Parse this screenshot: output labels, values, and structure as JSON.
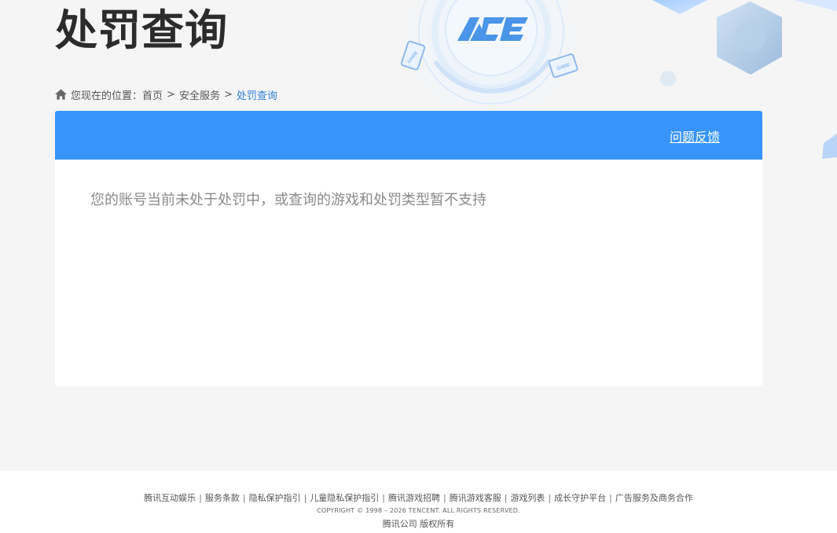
{
  "page": {
    "title": "处罚查询"
  },
  "banner": {
    "logo_text": "ACE",
    "badge_text_1": "GAME",
    "badge_text_2": "GAME"
  },
  "breadcrumb": {
    "prefix": "您现在的位置：",
    "items": [
      "首页",
      "安全服务",
      "处罚查询"
    ],
    "separator": ">"
  },
  "panel": {
    "feedback_label": "问题反馈",
    "message": "您的账号当前未处于处罚中，或查询的游戏和处罚类型暂不支持"
  },
  "footer": {
    "links": [
      "腾讯互动娱乐",
      "服务条款",
      "隐私保护指引",
      "儿童隐私保护指引",
      "腾讯游戏招聘",
      "腾讯游戏客服",
      "游戏列表",
      "成长守护平台",
      "广告服务及商务合作"
    ],
    "copyright": "COPYRIGHT © 1998 – 2026 TENCENT. ALL RIGHTS RESERVED.",
    "owner": "腾讯公司 版权所有"
  },
  "colors": {
    "header_blue": "#3794fb",
    "current_crumb": "#2f7fd8",
    "background": "#f5f5f5"
  }
}
